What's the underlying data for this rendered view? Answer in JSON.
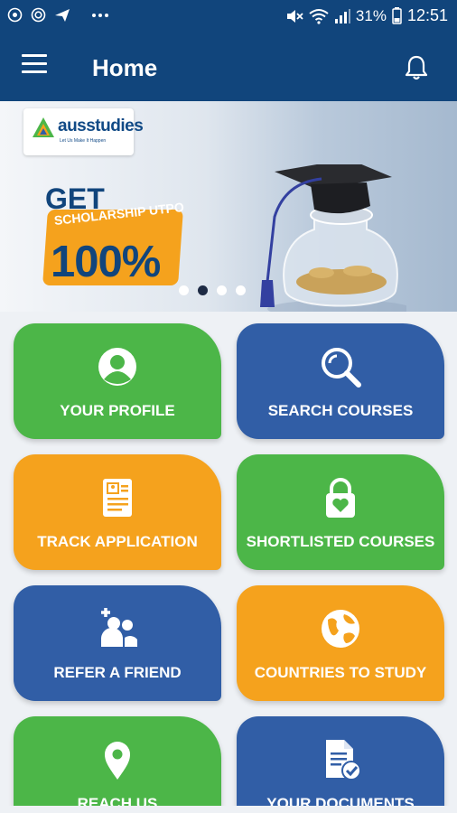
{
  "status_bar": {
    "battery": "31%",
    "time": "12:51"
  },
  "header": {
    "title": "Home"
  },
  "banner": {
    "logo_text": "ausstudies",
    "logo_tagline": "Let Us Make It Happen",
    "headline": "GET",
    "subline": "SCHOLARSHIP UTPO",
    "percent": "100%",
    "slides": 4,
    "active_slide": 2
  },
  "tiles": [
    {
      "label": "YOUR PROFILE",
      "icon": "profile-icon",
      "color": "#4cb648"
    },
    {
      "label": "SEARCH COURSES",
      "icon": "search-icon",
      "color": "#315ea6"
    },
    {
      "label": "TRACK APPLICATION",
      "icon": "application-icon",
      "color": "#f5a21d"
    },
    {
      "label": "SHORTLISTED COURSES",
      "icon": "lock-heart-icon",
      "color": "#4cb648"
    },
    {
      "label": "REFER A FRIEND",
      "icon": "add-friend-icon",
      "color": "#315ea6"
    },
    {
      "label": "COUNTRIES TO STUDY",
      "icon": "globe-icon",
      "color": "#f5a21d"
    },
    {
      "label": "REACH US",
      "icon": "location-pin-icon",
      "color": "#4cb648"
    },
    {
      "label": "YOUR DOCUMENTS",
      "icon": "document-check-icon",
      "color": "#315ea6"
    }
  ],
  "colors": {
    "app_bar": "#11457c",
    "green": "#4cb648",
    "blue": "#315ea6",
    "orange": "#f5a21d"
  }
}
